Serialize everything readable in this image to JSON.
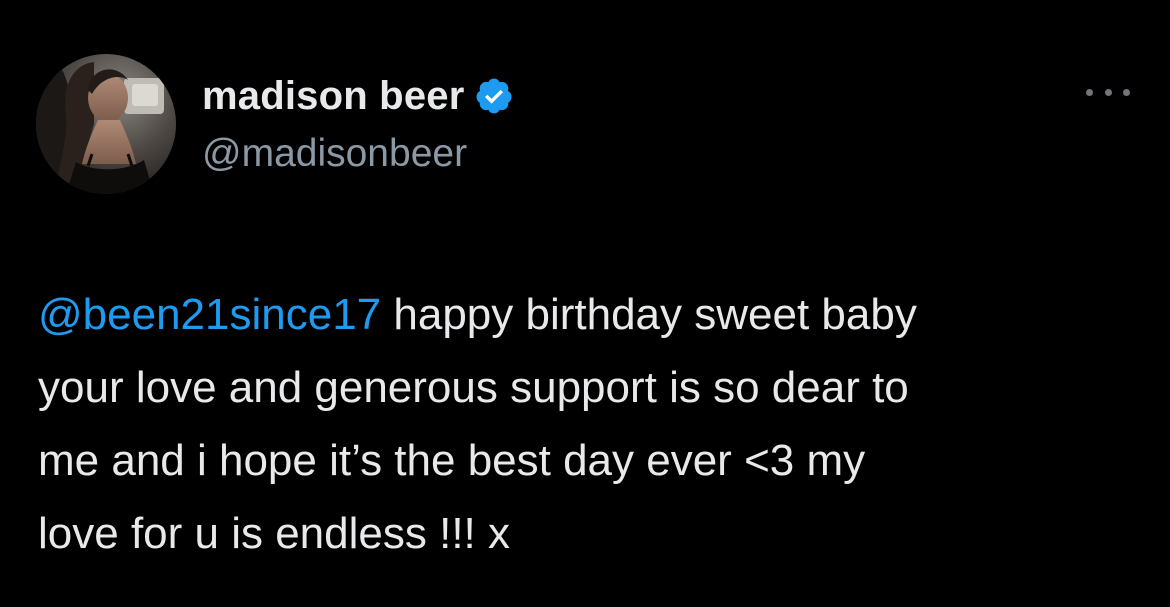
{
  "tweet": {
    "author": {
      "display_name": "madison beer",
      "handle": "@madisonbeer",
      "verified": true,
      "verified_icon": "verified-badge-icon",
      "avatar_icon": "avatar-photo"
    },
    "more_icon": "more-options-icon",
    "lines": [
      {
        "mention": "@been21since17",
        "text": " happy birthday sweet baby"
      },
      {
        "mention": "",
        "text": "your love and generous support is so dear to"
      },
      {
        "mention": "",
        "text": "me and i hope it’s the best day ever <3  my"
      },
      {
        "mention": "",
        "text": "love for u is endless !!! x"
      }
    ]
  },
  "colors": {
    "background": "#000000",
    "text": "#e7e9ea",
    "secondary_text": "#8b98a5",
    "mention": "#1d9bf0",
    "verified": "#1d9bf0"
  }
}
